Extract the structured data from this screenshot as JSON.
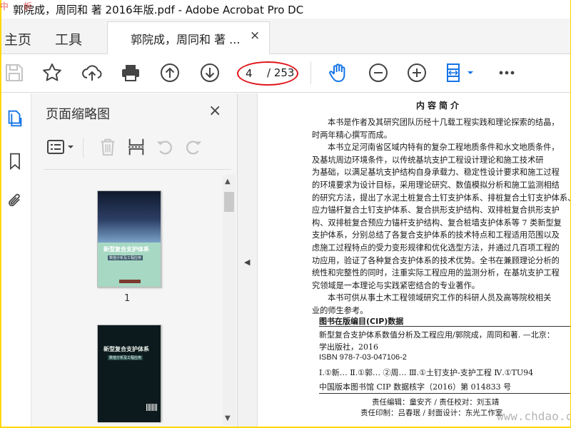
{
  "window": {
    "title": "郭院成，周同和 著 2016年版.pdf - Adobe Acrobat Pro DC"
  },
  "tabs": {
    "home": "主页",
    "tools": "工具",
    "document": "郭院成，周同和 著 ...",
    "close": "×"
  },
  "toolbar": {
    "current_page": "4",
    "total_pages": "/ 253",
    "icons": [
      "save-icon",
      "bookmark-star-icon",
      "upload-cloud-icon",
      "print-icon",
      "page-up-icon",
      "page-down-icon",
      "hand-tool-icon",
      "zoom-out-icon",
      "zoom-in-icon",
      "fit-page-icon",
      "more-icon"
    ],
    "accent": "#1473e6",
    "highlight": "#e0151b"
  },
  "sidebar": {
    "title": "页面缩略图",
    "close": "×",
    "thumbnails": [
      {
        "page_label": "1",
        "cover_title": "新型复合支护体系",
        "cover_subtitle": "数值分析及工程应用"
      },
      {
        "page_label": "",
        "cover_title": "新型复合支护体系",
        "cover_subtitle": "数值分析及工程应用"
      }
    ]
  },
  "document": {
    "heading": "内容简介",
    "paragraph_lines": [
      "本书是作者及其研究团队历经十几载工程实践和理论探索的结晶，",
      "时两年精心撰写而成。",
      "本书立足河南省区域内特有的复杂工程地质条件和水文地质条件，",
      "及基坑周边环境条件，以传统基坑支护工程设计理论和施工技术研",
      "为基础，以满足基坑支护结构自身承载力、稳定性设计要求和施工过程",
      "的环境要求为设计目标，采用理论研究、数值模拟分析和施工监测相结",
      "的研究方法，提出了水泥土桩复合土钉支护体系、排桩复合土钉支护体系、",
      "应力锚杆复合土钉支护体系、复合拱形支护结构、双排桩复合拱形支护",
      "构、双排桩复合预应力锚杆支护结构、复合桩墙支护体系等 7 类新型复",
      "支护体系，分别总结了各复合支护体系的技术特点和工程适用范围以及",
      "虑施工过程特点的受力变形规律和优化选型方法，并通过几百项工程的",
      "功应用，验证了各种复合支护体系的技术优势。全书在兼顾理论分析的",
      "统性和完整性的同时，注重实际工程应用的监测分析，在基坑支护工程",
      "究领域是一本理论与实践紧密结合的专业著作。",
      "本书可供从事土木工程领域研究工作的科研人员及高等院校相关",
      "业的师生参考。"
    ],
    "cip_title": "图书在版编目(CIP)数据",
    "cip_lines": [
      "新型复合支护体系数值分析及工程应用/郭院成，周同和著. —北京：",
      "学出版社，2016",
      "ISBN 978-7-03-047106-2",
      "Ⅰ.①新…  Ⅱ.①郭…  ②周…  Ⅲ.①土钉支护-支护工程  Ⅳ.①TU94",
      "中国版本图书馆 CIP 数据核字（2016）第 014833 号"
    ],
    "credit_lines": [
      "责任编辑：童安齐 / 责任校对：刘玉靖",
      "责任印制：吕春珉 / 封面设计：东光工作室"
    ]
  },
  "watermarks": {
    "top_left": "中     折",
    "bottom_right": "www.chdao.com"
  }
}
